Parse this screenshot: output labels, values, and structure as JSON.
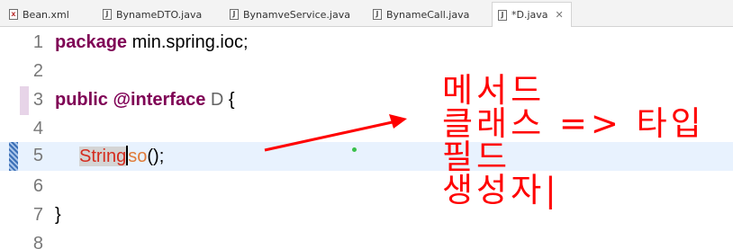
{
  "tabs": [
    {
      "label": "Bean.xml",
      "icon": "xml-file-icon"
    },
    {
      "label": "BynameDTO.java",
      "icon": "java-file-icon"
    },
    {
      "label": "BynamveService.java",
      "icon": "java-file-icon"
    },
    {
      "label": "BynameCall.java",
      "icon": "java-file-icon"
    },
    {
      "label": "*D.java",
      "icon": "java-file-icon",
      "active": true,
      "close": "✕"
    }
  ],
  "editor": {
    "line_numbers": [
      "1",
      "2",
      "3",
      "4",
      "5",
      "6",
      "7",
      "8"
    ],
    "line1": {
      "kw": "package",
      "rest": " min.spring.ioc;"
    },
    "line3": {
      "kw1": "public",
      "kw2": "@interface",
      "name": "D",
      "brace": " {"
    },
    "line5": {
      "type": "String",
      "method": "so",
      "rest": "();"
    },
    "line7": {
      "text": "}"
    },
    "current_line": "5"
  },
  "annotation": {
    "lines": [
      "메서드",
      "클래스 => 타입",
      "필드",
      "생성자|"
    ],
    "color": "#ff0000"
  },
  "colors": {
    "keyword": "#7f0055",
    "line_number": "#787878",
    "current_line_bg": "#e8f2fe",
    "method": "#e07b39",
    "type_highlight": "#d52b1e"
  }
}
